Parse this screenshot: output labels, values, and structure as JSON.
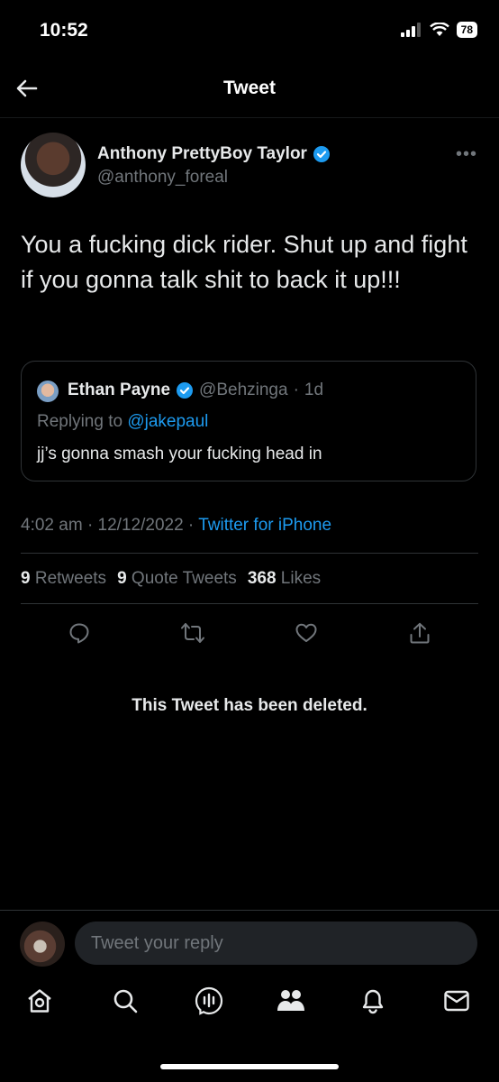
{
  "status_bar": {
    "time": "10:52",
    "battery": "78"
  },
  "header": {
    "title": "Tweet"
  },
  "tweet": {
    "author_name": "Anthony PrettyBoy Taylor",
    "author_handle": "@anthony_foreal",
    "text": "You a fucking dick rider. Shut up and fight if you gonna talk shit to back it up!!!",
    "time": "4:02 am",
    "date": "12/12/2022",
    "source": "Twitter for iPhone",
    "retweets_count": "9",
    "retweets_label": "Retweets",
    "quote_tweets_count": "9",
    "quote_tweets_label": "Quote Tweets",
    "likes_count": "368",
    "likes_label": "Likes"
  },
  "quoted_tweet": {
    "author_name": "Ethan Payne",
    "author_handle": "@Behzinga",
    "age": "1d",
    "replying_to_label": "Replying to",
    "replying_to_handle": "@jakepaul",
    "text": "jj’s gonna smash your fucking head in"
  },
  "deleted_notice": "This Tweet has been deleted.",
  "reply": {
    "placeholder": "Tweet your reply"
  },
  "colors": {
    "accent": "#1d9bf0",
    "background": "#000000",
    "secondary_text": "#71767b"
  }
}
